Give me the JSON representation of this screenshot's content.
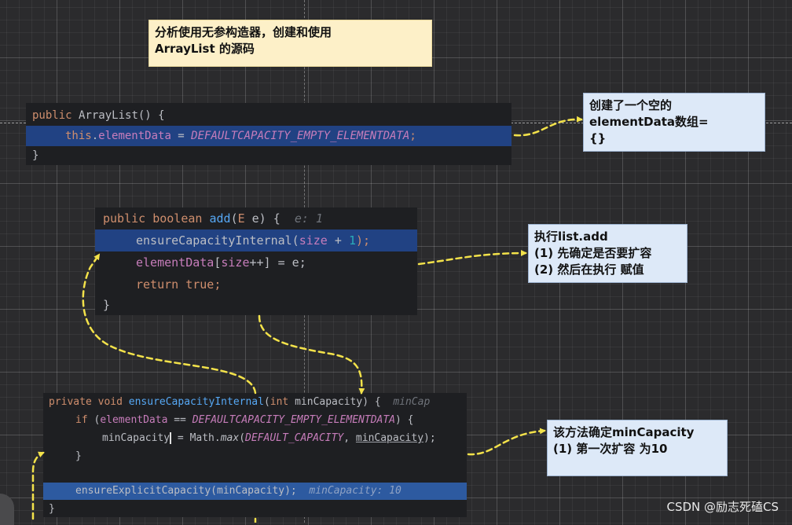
{
  "notes": {
    "title": "分析使用无参构造器，创建和使用\nArrayList 的源码",
    "empty_array": "创建了一个空的\nelementData数组=\n{}",
    "add_steps": "执行list.add\n(1) 先确定是否要扩容\n(2) 然后在执行 赋值",
    "min_capacity": "该方法确定minCapacity\n(1) 第一次扩容 为10"
  },
  "code_constructor": {
    "l1_kw": "public",
    "l1_name": "ArrayList",
    "l1_rest": "() {",
    "l2_this": "this",
    "l2_dot": ".",
    "l2_field": "elementData",
    "l2_eq": " = ",
    "l2_const": "DEFAULTCAPACITY_EMPTY_ELEMENTDATA",
    "l2_semi": ";",
    "l3": "}"
  },
  "code_add": {
    "l1_kw1": "public",
    "l1_kw2": "boolean",
    "l1_name": "add",
    "l1_open": "(",
    "l1_type": "E",
    "l1_rest": " e) {",
    "l1_hint": "e: 1",
    "l2_call": "ensureCapacityInternal(",
    "l2_field": "size",
    "l2_op": " + ",
    "l2_num": "1",
    "l2_end": ");",
    "l3_field": "elementData",
    "l3_open": "[",
    "l3_field2": "size",
    "l3_rest": "++] = e;",
    "l4_kw": "return",
    "l4_val": "true",
    "l4_semi": ";",
    "l5": "}"
  },
  "code_ensure": {
    "l1_kw1": "private",
    "l1_kw2": "void",
    "l1_name": "ensureCapacityInternal",
    "l1_open": "(",
    "l1_kw3": "int",
    "l1_param": "minCapacity",
    "l1_close": ") {",
    "l1_hint": "minCap",
    "l2_kw": "if",
    "l2_open": " (",
    "l2_field": "elementData",
    "l2_op": " == ",
    "l2_const": "DEFAULTCAPACITY_EMPTY_ELEMENTDATA",
    "l2_close": ") {",
    "l3_var": "minCapacity",
    "l3_eq": " = Math.",
    "l3_fn": "max",
    "l3_open": "(",
    "l3_const": "DEFAULT_CAPACITY",
    "l3_comma": ", ",
    "l3_param": "minCapacity",
    "l3_close": ");",
    "l4": "}",
    "l5_call": "ensureExplicitCapacity(minCapacity);",
    "l5_hint": "minCapacity: 10",
    "l6": "}"
  },
  "watermark": "CSDN @励志死磕CS",
  "colors": {
    "arrow": "#f3e24a",
    "code_bg": "#1e1f22",
    "highlight": "#214283",
    "note_yellow": "#fdf0c8",
    "note_blue": "#dde9f8"
  }
}
